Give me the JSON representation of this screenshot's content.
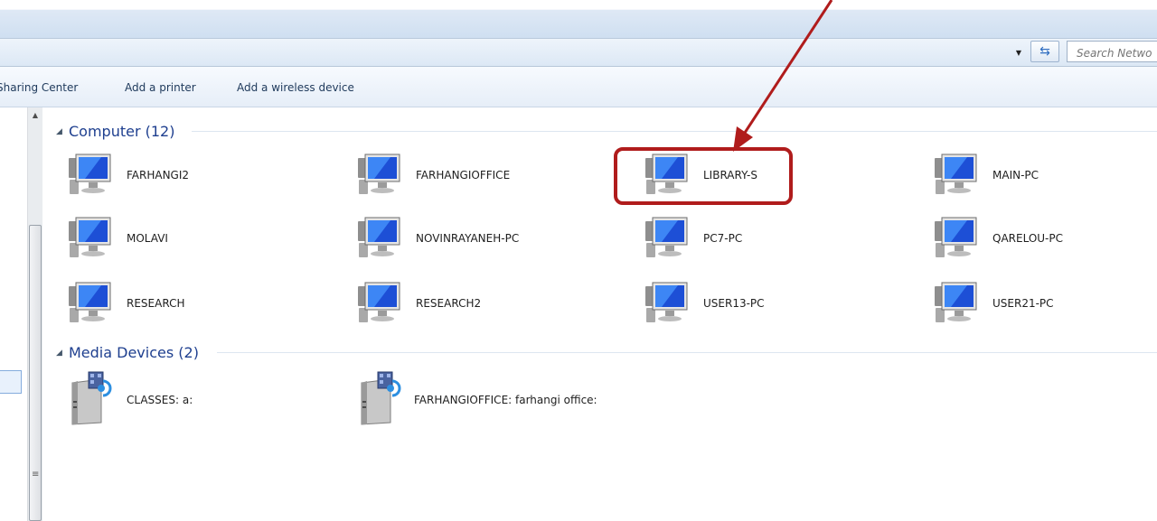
{
  "search": {
    "placeholder": "Search Netwo"
  },
  "toolbar": {
    "items": [
      "Sharing Center",
      "Add a printer",
      "Add a wireless device"
    ]
  },
  "groups": [
    {
      "label": "Computer (12)"
    },
    {
      "label": "Media Devices (2)"
    }
  ],
  "computers": [
    "FARHANGI2",
    "FARHANGIOFFICE",
    "LIBRARY-S",
    "MAIN-PC",
    "MOLAVI",
    "NOVINRAYANEH-PC",
    "PC7-PC",
    "QARELOU-PC",
    "RESEARCH",
    "RESEARCH2",
    "USER13-PC",
    "USER21-PC"
  ],
  "media_devices": [
    "CLASSES: a:",
    "FARHANGIOFFICE: farhangi office:"
  ],
  "annotation": {
    "highlighted_item": "LIBRARY-S",
    "color": "#b01c1c"
  },
  "icons": {
    "computer": "computer-monitor-icon",
    "media": "media-server-icon",
    "refresh": "refresh-icon",
    "dropdown": "chevron-down-icon"
  }
}
